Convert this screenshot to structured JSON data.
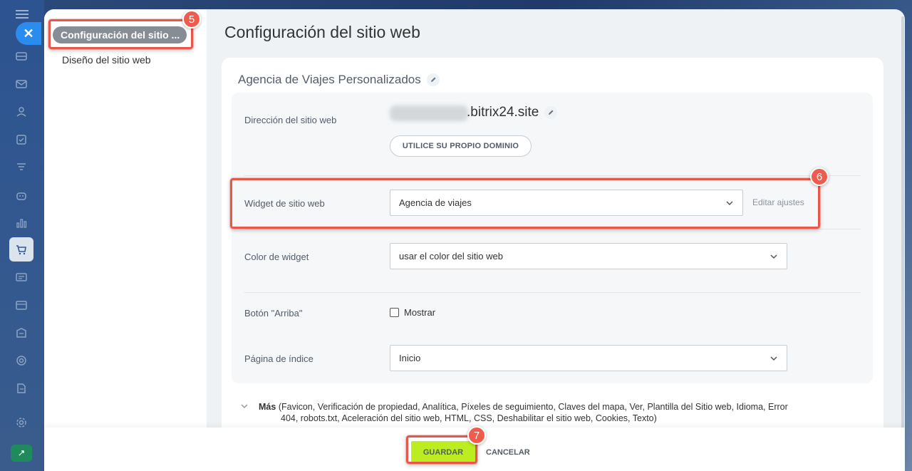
{
  "app": {
    "close_icon": "close-icon",
    "rail_icons": [
      "menu-icon",
      "drive-icon",
      "mail-icon",
      "contacts-icon",
      "tasks-icon",
      "funnel-icon",
      "robot-icon",
      "analytics-icon",
      "shop-icon",
      "card-icon",
      "calendar-icon",
      "building-icon",
      "target-icon",
      "document-edit-icon",
      "settings-icon",
      "rocket-icon"
    ]
  },
  "sidebar": {
    "items": [
      {
        "label": "Configuración del sitio ...",
        "active": true
      },
      {
        "label": "Diseño del sitio web",
        "active": false
      }
    ]
  },
  "main": {
    "title": "Configuración del sitio web",
    "site_name": "Agencia de Viajes Personalizados",
    "address": {
      "label": "Dirección del sitio web",
      "value": ".bitrix24.site",
      "domain_button": "UTILICE SU PROPIO DOMINIO"
    },
    "widget": {
      "label": "Widget de sitio web",
      "value": "Agencia de viajes",
      "edit_link": "Editar ajustes"
    },
    "color": {
      "label": "Color de widget",
      "value": "usar el color del sitio web"
    },
    "top_button": {
      "label": "Botón \"Arriba\"",
      "checkbox_label": "Mostrar",
      "checked": false
    },
    "index_page": {
      "label": "Página de índice",
      "value": "Inicio"
    },
    "more": {
      "label": "Más",
      "line1": "(Favicon,  Verificación de propiedad,  Analítica,  Píxeles de seguimiento,  Claves del mapa,  Ver,  Plantilla del Sitio web,  Idioma,  Error",
      "line2": "404,  robots.txt,  Aceleración del sitio web,  HTML,  CSS,  Deshabilitar el sitio web,  Cookies,  Texto)"
    }
  },
  "footer": {
    "save_label": "GUARDAR",
    "cancel_label": "CANCELAR"
  },
  "annotations": {
    "step5": "5",
    "step6": "6",
    "step7": "7"
  },
  "colors": {
    "accent": "#2b8cf0",
    "save": "#bbed21",
    "callout": "#e8574a"
  }
}
